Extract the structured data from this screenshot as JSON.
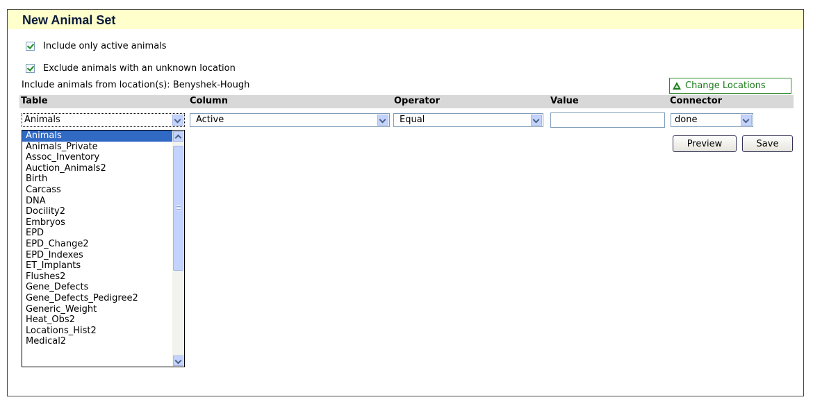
{
  "panel": {
    "title": "New Animal Set"
  },
  "options": {
    "active_only": {
      "label": "Include only active animals",
      "checked": true
    },
    "exclude_unknown": {
      "label": "Exclude animals with an unknown location",
      "checked": true
    }
  },
  "locations": {
    "text": "Include animals from location(s): Benyshek-Hough",
    "change_label": "Change Locations"
  },
  "columns": [
    "Table",
    "Column",
    "Operator",
    "Value",
    "Connector"
  ],
  "filter_row": {
    "table": "Animals",
    "column": "Active",
    "operator": "Equal",
    "value": "",
    "connector": "done"
  },
  "buttons": {
    "preview": "Preview",
    "save": "Save"
  },
  "table_dropdown": {
    "selected_index": 0,
    "items": [
      "Animals",
      "Animals_Private",
      "Assoc_Inventory",
      "Auction_Animals2",
      "Birth",
      "Carcass",
      "DNA",
      "Docility2",
      "Embryos",
      "EPD",
      "EPD_Change2",
      "EPD_Indexes",
      "ET_Implants",
      "Flushes2",
      "Gene_Defects",
      "Gene_Defects_Pedigree2",
      "Generic_Weight",
      "Heat_Obs2",
      "Locations_Hist2",
      "Medical2"
    ]
  },
  "colors": {
    "title_bg": "#ffffcc",
    "header_bg": "#d8d8d8",
    "selection": "#316ac5",
    "accent_green": "#1a7a1a"
  }
}
